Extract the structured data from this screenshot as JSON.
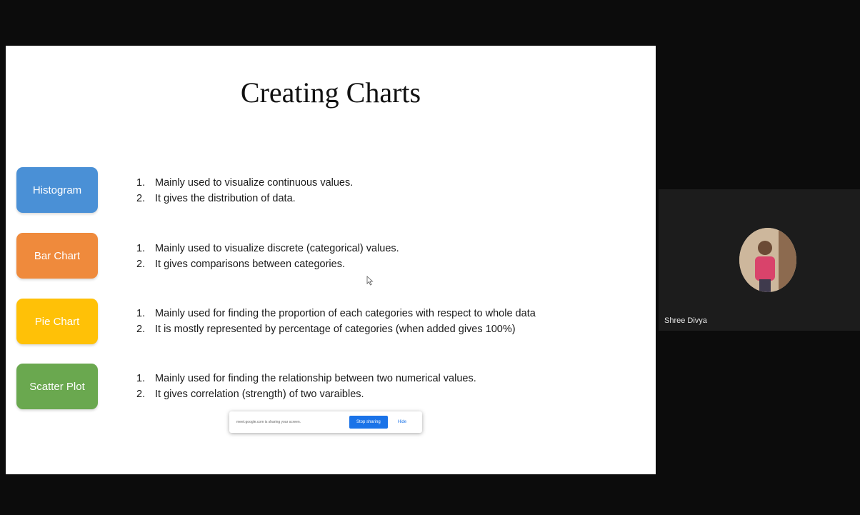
{
  "slide": {
    "title": "Creating Charts",
    "items": [
      {
        "label": "Histogram",
        "color": "#4a90d6",
        "points": [
          "Mainly used to visualize continuous values.",
          "It gives the distribution of data."
        ]
      },
      {
        "label": "Bar Chart",
        "color": "#ef8a3c",
        "points": [
          "Mainly used to visualize discrete (categorical) values.",
          "It gives comparisons between categories."
        ]
      },
      {
        "label": "Pie Chart",
        "color": "#ffc107",
        "points": [
          "Mainly used for finding the proportion of each categories with respect to whole data",
          "It is mostly represented by percentage of categories (when added gives 100%)"
        ]
      },
      {
        "label": "Scatter Plot",
        "color": "#6aa84f",
        "points": [
          "Mainly used for finding the relationship between two numerical values.",
          "It gives correlation (strength) of two varaibles."
        ]
      }
    ]
  },
  "share_bar": {
    "message": "meet.google.com is sharing your screen.",
    "stop_label": "Stop sharing",
    "hide_label": "Hide"
  },
  "participant": {
    "name": "Shree Divya"
  }
}
